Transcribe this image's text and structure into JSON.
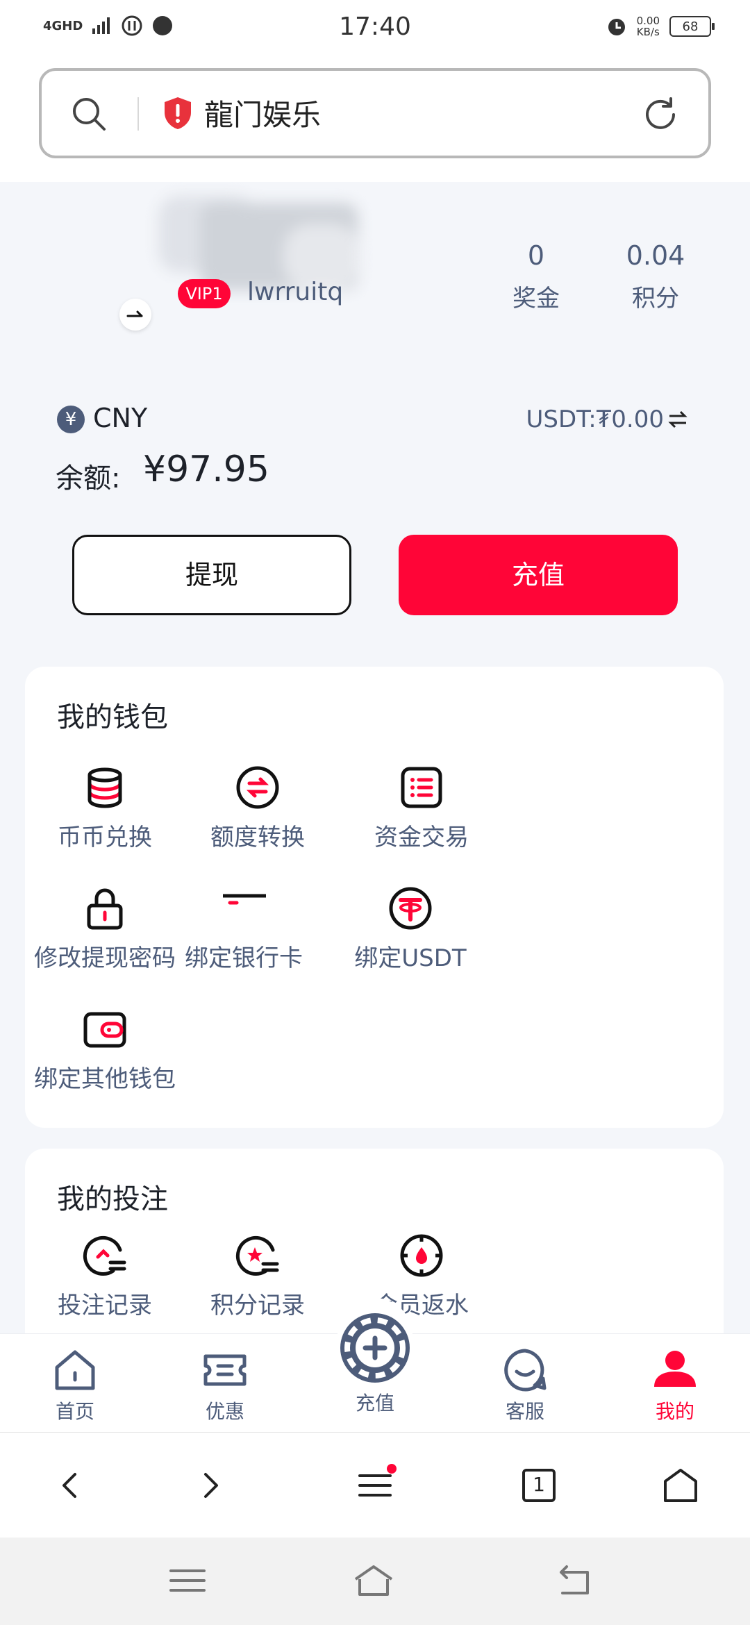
{
  "status_bar": {
    "network": "4GHD",
    "time": "17:40",
    "net_rate_value": "0.00",
    "net_rate_unit": "KB/s",
    "battery": "68"
  },
  "address_bar": {
    "site_name": "龍门娱乐"
  },
  "profile": {
    "vip_level": "VIP1",
    "username": "lwrruitq",
    "stats": [
      {
        "value": "0",
        "label": "奖金"
      },
      {
        "value": "0.04",
        "label": "积分"
      }
    ]
  },
  "balance": {
    "currency_symbol": "¥",
    "currency": "CNY",
    "usdt_balance": "USDT:₮0.00",
    "label": "余额:",
    "amount": "¥97.95"
  },
  "actions": {
    "withdraw": "提现",
    "recharge": "充值"
  },
  "wallet": {
    "title": "我的钱包",
    "items": [
      {
        "label": "币币兑换",
        "icon": "coin-stack-icon"
      },
      {
        "label": "额度转换",
        "icon": "transfer-icon"
      },
      {
        "label": "资金交易",
        "icon": "list-icon"
      },
      {
        "label": "修改提现密码",
        "icon": "lock-icon"
      },
      {
        "label": "绑定银行卡",
        "icon": "bank-card-icon"
      },
      {
        "label": "绑定USDT",
        "icon": "usdt-icon"
      },
      {
        "label": "绑定其他钱包",
        "icon": "wallet-icon"
      }
    ]
  },
  "bets": {
    "title": "我的投注",
    "items": [
      {
        "label": "投注记录",
        "icon": "bet-record-icon"
      },
      {
        "label": "积分记录",
        "icon": "points-record-icon"
      },
      {
        "label": "会员返水",
        "icon": "rebate-icon"
      }
    ]
  },
  "bottom_nav": {
    "items": [
      {
        "label": "首页",
        "icon": "home-icon"
      },
      {
        "label": "优惠",
        "icon": "ticket-icon"
      },
      {
        "label": "充值",
        "icon": "chip-plus-icon"
      },
      {
        "label": "客服",
        "icon": "chat-icon"
      },
      {
        "label": "我的",
        "icon": "user-icon"
      }
    ],
    "active": "我的"
  },
  "browser_toolbar": {
    "tab_count": "1"
  },
  "colors": {
    "accent": "#ff0537",
    "text_secondary": "#4d5c7a",
    "background": "#f4f6fa"
  }
}
